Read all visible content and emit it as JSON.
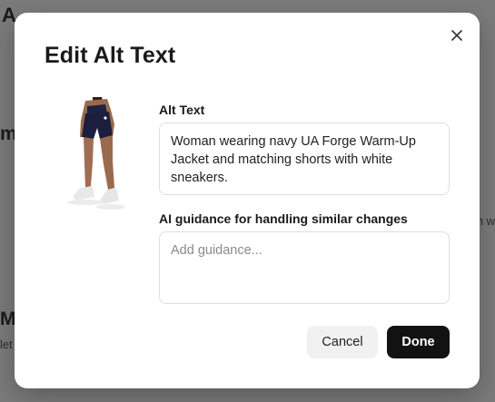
{
  "background": {
    "fragments": [
      "A",
      "ma",
      "Me",
      "let",
      "h w"
    ]
  },
  "modal": {
    "title": "Edit Alt Text",
    "close_icon": "close-icon",
    "image": {
      "icon": "product-photo"
    },
    "alt_text": {
      "label": "Alt Text",
      "value": "Woman wearing navy UA Forge Warm-Up Jacket and matching shorts with white sneakers."
    },
    "ai_guidance": {
      "label": "AI guidance for handling similar changes",
      "placeholder": "Add guidance...",
      "value": ""
    },
    "buttons": {
      "cancel": "Cancel",
      "done": "Done"
    }
  },
  "colors": {
    "overlay": "#7b7b7b",
    "primary_button": "#121212",
    "secondary_button": "#f1f1f1",
    "border": "#dedede"
  }
}
